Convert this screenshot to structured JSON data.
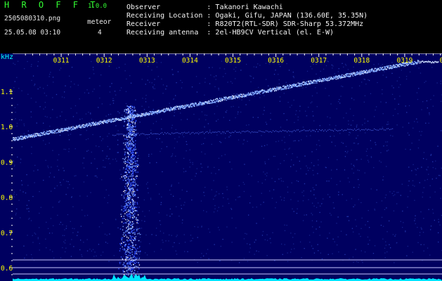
{
  "app": {
    "name": "H R O F F T",
    "version": "1.0.0"
  },
  "capture": {
    "filename": "2505080310.png",
    "datetime": "25.05.08 03:10",
    "meteor_label": "meteor",
    "meteor_count": "4"
  },
  "station": {
    "observer": "Observer           : Takanori Kawachi",
    "location": "Receiving Location : Ogaki, Gifu, JAPAN (136.60E, 35.35N)",
    "receiver": "Receiver           : R820T2(RTL-SDR) SDR-Sharp 53.372MHz",
    "antenna": "Receiving antenna  : 2el-HB9CV Vertical (el. E-W)"
  },
  "colors": {
    "background": "#000000",
    "signal": "#3355ff",
    "carrier": "#7fa8ff",
    "tick_label": "#ffff00",
    "axis_label": "#00ffff",
    "baseline": "#00e5ff",
    "brand": "#33ff33"
  },
  "spectrogram": {
    "y_unit": "kHz",
    "y_ticks": [
      "1.1",
      "1.0",
      "0.9",
      "0.8",
      "0.7",
      "0.6"
    ],
    "y_tick_values": [
      1.1,
      1.0,
      0.9,
      0.8,
      0.7,
      0.6
    ],
    "y_range": [
      0.56,
      1.2
    ],
    "time_ticks": [
      "0311",
      "0312",
      "0313",
      "0314",
      "0315",
      "0316",
      "0317",
      "0318",
      "0319",
      "0320"
    ],
    "time_range_minutes": [
      3.1,
      3.2
    ],
    "carrier_trace": {
      "start_khz": 0.965,
      "end_khz": 1.185
    },
    "meteor_echo": {
      "time": "0312.6",
      "freq_range_khz": [
        0.56,
        1.06
      ]
    }
  }
}
